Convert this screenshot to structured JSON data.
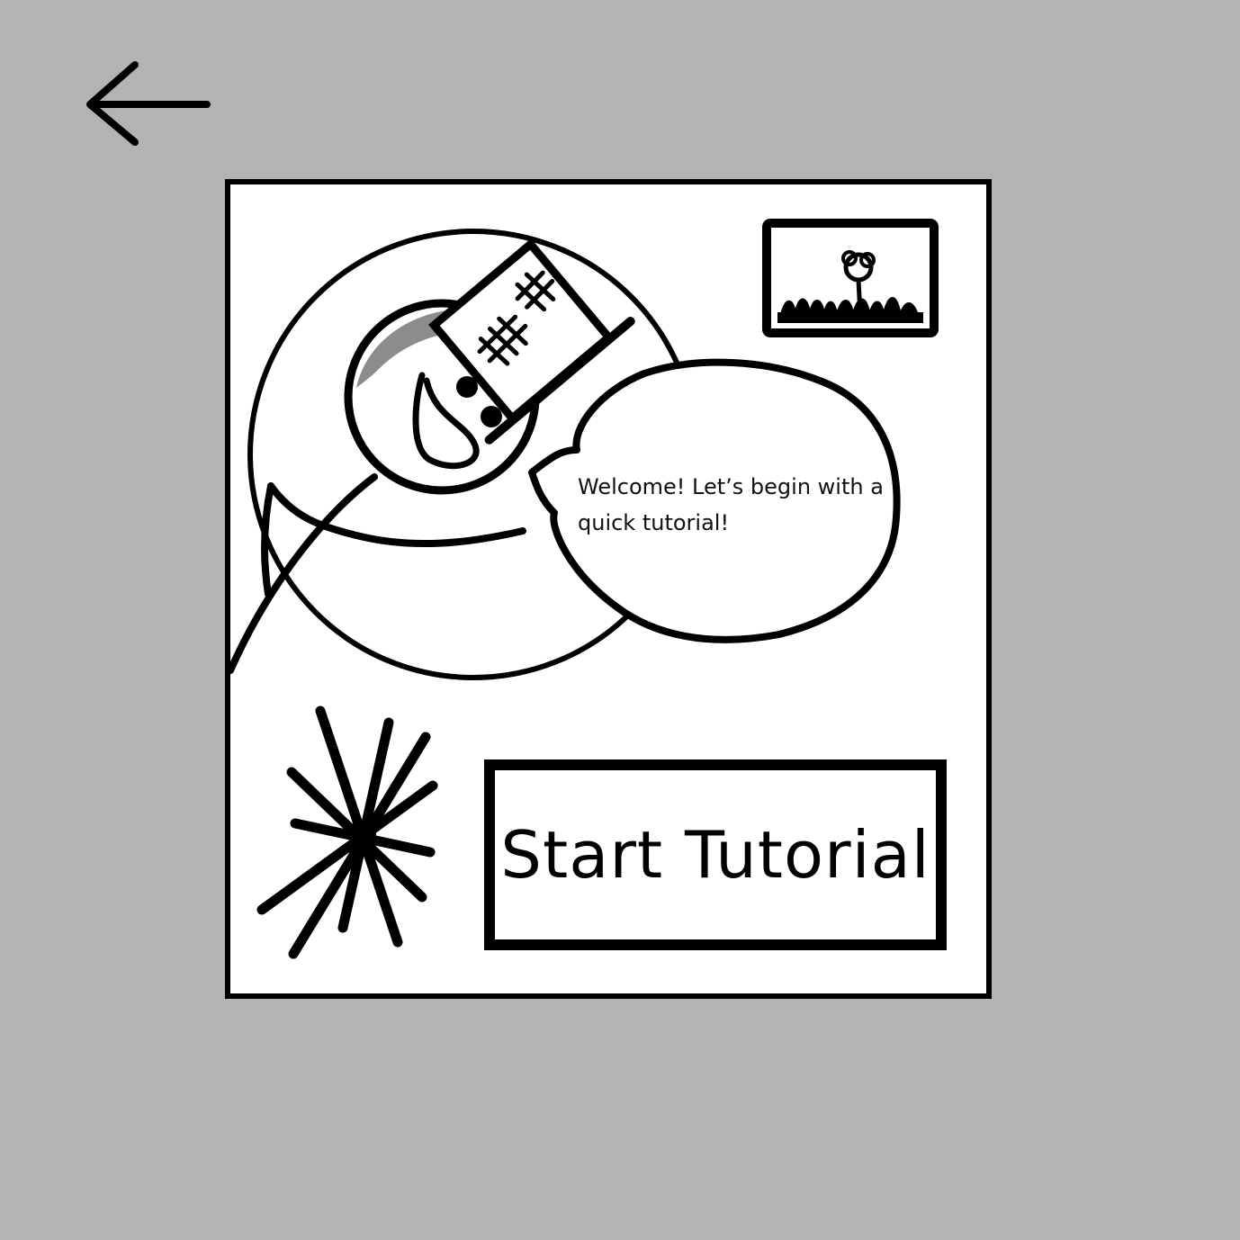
{
  "nav": {
    "back_icon": "arrow-left-icon"
  },
  "card": {
    "mascot_icon": "snowman-mascot-icon",
    "thumbnail_icon": "flower-picture-icon",
    "sparkle_icon": "sparkle-burst-icon",
    "speech": {
      "text": "Welcome! Let’s begin with a quick tutorial!"
    },
    "start_button": {
      "label": "Start Tutorial"
    }
  },
  "colors": {
    "background": "#b3b3b3",
    "card": "#ffffff",
    "ink": "#000000",
    "hat_brim_shadow": "#8c8c8c"
  }
}
